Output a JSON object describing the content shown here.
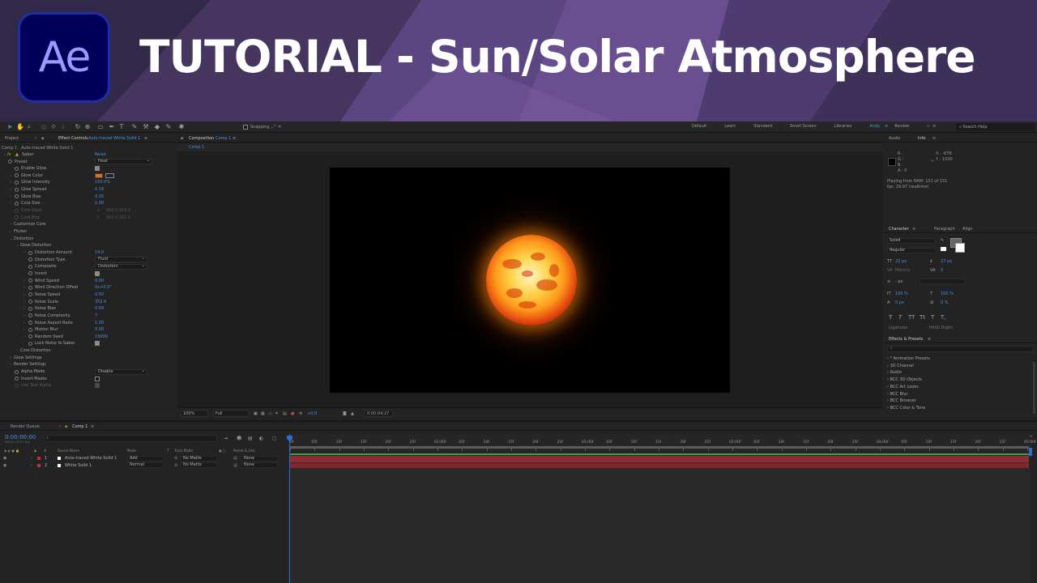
{
  "banner": {
    "logo_text": "Ae",
    "title": "TUTORIAL - Sun/Solar Atmosphere"
  },
  "toolbar": {
    "snapping_label": "Snapping",
    "workspaces": [
      "Default",
      "Learn",
      "Standard",
      "Small Screen",
      "Libraries",
      "Andy",
      "Review"
    ],
    "active_workspace": "Andy",
    "search_placeholder": "Search Help"
  },
  "effect_panel": {
    "tab_project": "Project",
    "tab_effect": "Effect Controls",
    "tab_effect_layer": "Auto-traced White Solid 1",
    "breadcrumb": "Comp 1 · Auto-traced White Solid 1",
    "effect_name": "Saber",
    "reset_label": "Reset",
    "rows": [
      {
        "label": "Preset",
        "type": "dropdown",
        "value": "Heat",
        "indent": 18
      },
      {
        "label": "Enable Glow",
        "type": "check",
        "value": "",
        "indent": 26
      },
      {
        "label": "Glow Color",
        "type": "color",
        "value": "",
        "indent": 26
      },
      {
        "label": "Glow Intensity",
        "type": "num",
        "value": "150.0%",
        "indent": 26
      },
      {
        "label": "Glow Spread",
        "type": "num",
        "value": "0.18",
        "indent": 26
      },
      {
        "label": "Glow Bias",
        "type": "num",
        "value": "0.35",
        "indent": 26
      },
      {
        "label": "Core Size",
        "type": "num",
        "value": "1.00",
        "indent": 26
      },
      {
        "label": "Core Start",
        "type": "dim",
        "value": "960.0,918.0",
        "indent": 26
      },
      {
        "label": "Core End",
        "type": "dim",
        "value": "960.0,162.0",
        "indent": 26
      },
      {
        "label": "Customize Core",
        "type": "group",
        "value": "",
        "indent": 17
      },
      {
        "label": "Flicker",
        "type": "group",
        "value": "",
        "indent": 17
      },
      {
        "label": "Distortion",
        "type": "group",
        "value": "",
        "indent": 17
      },
      {
        "label": "Glow Distortion",
        "type": "group",
        "value": "",
        "indent": 25
      },
      {
        "label": "Distortion Amount",
        "type": "num",
        "value": "14.0",
        "indent": 43
      },
      {
        "label": "Distortion Type",
        "type": "dropdown",
        "value": "Fluid",
        "indent": 43
      },
      {
        "label": "Composite",
        "type": "dropdown",
        "value": "Distortion",
        "indent": 43
      },
      {
        "label": "Invert",
        "type": "check",
        "value": "",
        "indent": 43
      },
      {
        "label": "Wind Speed",
        "type": "num",
        "value": "0.00",
        "indent": 43
      },
      {
        "label": "Wind Direction Offset",
        "type": "num",
        "value": "0x+0.0°",
        "indent": 43
      },
      {
        "label": "Noise Speed",
        "type": "num",
        "value": "0.50",
        "indent": 43
      },
      {
        "label": "Noise Scale",
        "type": "num",
        "value": "352.0",
        "indent": 43
      },
      {
        "label": "Noise Bias",
        "type": "num",
        "value": "0.99",
        "indent": 43
      },
      {
        "label": "Noise Complexity",
        "type": "num",
        "value": "7",
        "indent": 43
      },
      {
        "label": "Noise Aspect Ratio",
        "type": "num",
        "value": "1.00",
        "indent": 43
      },
      {
        "label": "Motion Blur",
        "type": "num",
        "value": "0.00",
        "indent": 43
      },
      {
        "label": "Random Seed",
        "type": "num",
        "value": "23000",
        "indent": 43
      },
      {
        "label": "Lock Noise to Saber",
        "type": "check",
        "value": "",
        "indent": 43
      },
      {
        "label": "Core Distortion",
        "type": "group",
        "value": "",
        "indent": 25
      },
      {
        "label": "Glow Settings",
        "type": "group",
        "value": "",
        "indent": 17
      },
      {
        "label": "Render Settings",
        "type": "group",
        "value": "",
        "indent": 17
      },
      {
        "label": "Alpha Mode",
        "type": "dropdown",
        "value": "Disable",
        "indent": 26
      },
      {
        "label": "Invert Masks",
        "type": "check-off",
        "value": "",
        "indent": 26
      },
      {
        "label": "Use Text Alpha",
        "type": "dim-check",
        "value": "",
        "indent": 26
      }
    ]
  },
  "composition": {
    "tab_label": "Composition",
    "tab_comp": "Comp 1",
    "sub_tab": "Comp 1",
    "zoom": "100%",
    "resolution": "Full",
    "exposure": "+0.0",
    "timecode": "0:00:04:27"
  },
  "info_panel": {
    "tab_audio": "Audio",
    "tab_info": "Info",
    "r": "R :",
    "g": "G :",
    "b": "B :",
    "a": "A : 0",
    "x": "X : -676",
    "y": "Y : 1030",
    "playing": "Playing from RAM: 151 of 151",
    "fps": "fps: 29.97 (realtime)"
  },
  "character_panel": {
    "tab_character": "Character",
    "tab_paragraph": "Paragraph",
    "tab_align": "Align",
    "font": "Soleil",
    "style": "Regular",
    "size": "22 px",
    "leading": "27 px",
    "kerning": "Metrics",
    "tracking": "0",
    "stroke": "- px",
    "vscale": "100 %",
    "hscale": "100 %",
    "baseline": "0 px",
    "tsume": "0 %",
    "ligatures": "Ligatures",
    "hindi": "Hindi Digits",
    "typestyles": [
      "T",
      "T",
      "TT",
      "Tt",
      "T",
      "T,"
    ]
  },
  "presets_panel": {
    "title": "Effects & Presets",
    "search_placeholder": "",
    "items": [
      "* Animation Presets",
      "3D Channel",
      "Audio",
      "BCC 3D Objects",
      "BCC Art Looks",
      "BCC Blur",
      "BCC Browser",
      "BCC Color & Tone"
    ]
  },
  "timeline": {
    "tab_render": "Render Queue",
    "tab_comp": "Comp 1",
    "timecode": "0:00:00:00",
    "timecode_sub": "00000 (29.97 fps)",
    "headers": {
      "source": "Source Name",
      "mode": "Mode",
      "t": "T",
      "trkmat": "Track Matte",
      "parent": "Parent & Link"
    },
    "layers": [
      {
        "num": "1",
        "name": "Auto-traced White Solid 1",
        "mode": "Add",
        "matte": "No Matte",
        "parent": "None"
      },
      {
        "num": "2",
        "name": "White Solid 1",
        "mode": "Normal",
        "matte": "No Matte",
        "parent": "None"
      }
    ],
    "ruler_ticks": [
      "0f",
      "05f",
      "10f",
      "15f",
      "20f",
      "25f",
      "01:00f",
      "05f",
      "10f",
      "15f",
      "20f",
      "25f",
      "02:00f",
      "05f",
      "10f",
      "15f",
      "20f",
      "25f",
      "03:00f",
      "05f",
      "10f",
      "15f",
      "20f",
      "25f",
      "04:00f",
      "05f",
      "10f",
      "15f",
      "20f",
      "25f",
      "05:00f"
    ]
  },
  "colors": {
    "accent_blue": "#4a90e0",
    "layer1_bar": "#8b2e33",
    "layer2_bar": "#7d2a2e",
    "glow_color": "#e86a1c"
  }
}
